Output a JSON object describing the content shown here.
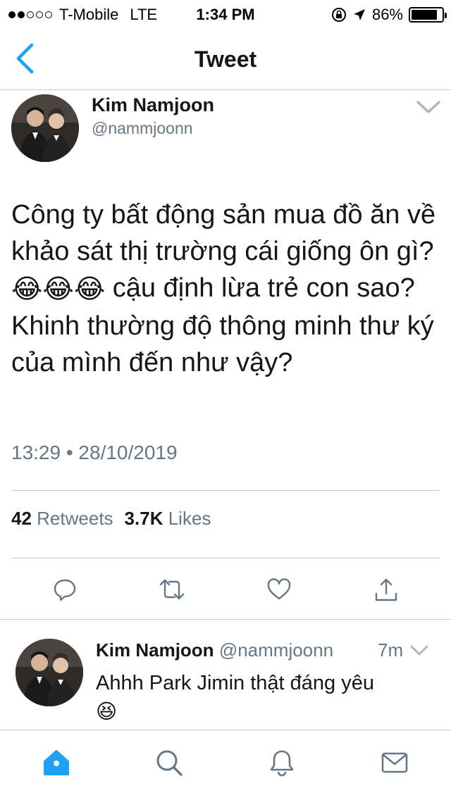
{
  "status_bar": {
    "carrier": "T-Mobile",
    "network": "LTE",
    "time": "1:34 PM",
    "battery": "86%",
    "battery_level": 0.86,
    "signal_bars_filled": 2,
    "signal_bars_total": 5
  },
  "nav": {
    "title": "Tweet",
    "back_icon": "chevron-left-icon"
  },
  "tweet": {
    "author_name": "Kim Namjoon",
    "author_handle": "@nammjoonn",
    "text_part1": "Công ty bất động sản mua đồ ăn về khảo sát thị trường cái giống ôn gì? ",
    "emojis": [
      "😂",
      "😂",
      "😂"
    ],
    "text_part2": " cậu định lừa trẻ con sao? Khinh thường độ thông minh thư ký của mình đến như vậy?",
    "timestamp": "13:29 • 28/10/2019",
    "retweet_count": "42",
    "retweet_label": "Retweets",
    "like_count": "3.7K",
    "like_label": "Likes"
  },
  "actions": [
    "reply-icon",
    "retweet-icon",
    "like-icon",
    "share-icon"
  ],
  "reply": {
    "author_name": "Kim Namjoon",
    "author_handle": "@nammjoonn",
    "time": "7m",
    "text": "Ahhh Park Jimin thật đáng yêu",
    "emoji": "😆"
  },
  "tabs": [
    "home-icon",
    "search-icon",
    "notifications-icon",
    "messages-icon"
  ],
  "colors": {
    "accent": "#1da1f2",
    "text": "#14171a",
    "secondary": "#657786",
    "divider": "#c8ccd0",
    "icon_gray": "#657786"
  }
}
